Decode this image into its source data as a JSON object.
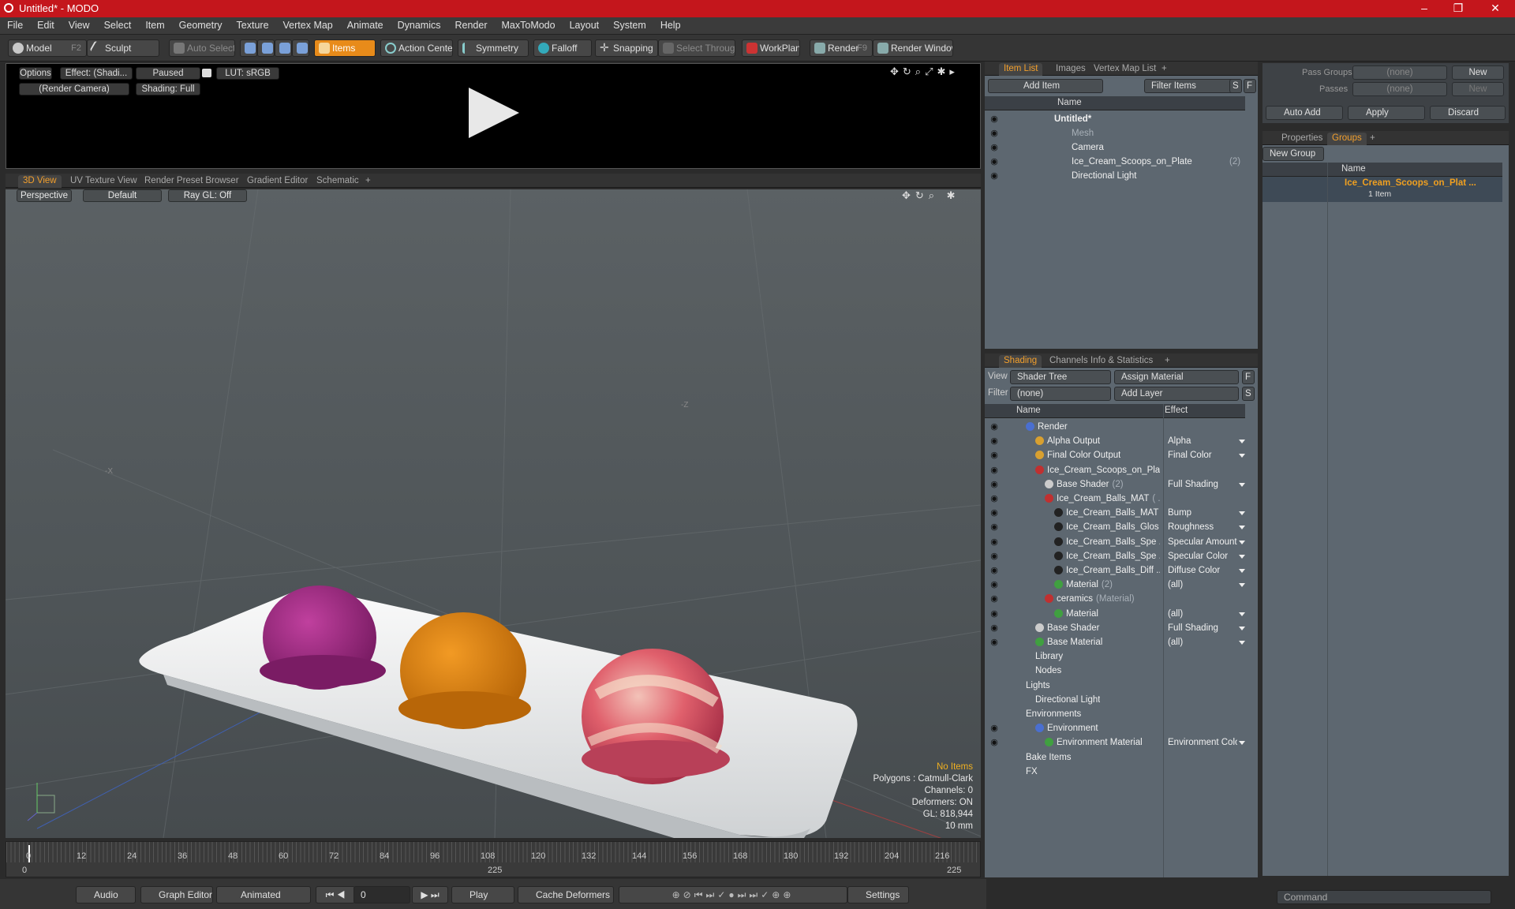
{
  "window": {
    "title": "Untitled* - MODO",
    "min": "–",
    "max": "❐",
    "close": "✕"
  },
  "menu": [
    "File",
    "Edit",
    "View",
    "Select",
    "Item",
    "Geometry",
    "Texture",
    "Vertex Map",
    "Animate",
    "Dynamics",
    "Render",
    "MaxToModo",
    "Layout",
    "System",
    "Help"
  ],
  "toolbar": {
    "model": "Model",
    "model_key": "F2",
    "sculpt": "Sculpt",
    "auto_select": "Auto Select",
    "items": "Items",
    "action_center": "Action Center",
    "symmetry": "Symmetry",
    "falloff": "Falloff",
    "snapping": "Snapping",
    "select_through": "Select Through",
    "workplane": "WorkPlane",
    "render": "Render",
    "render_key": "F9",
    "render_window": "Render Window"
  },
  "preview": {
    "options": "Options",
    "effect": "Effect: (Shadi...",
    "paused": "Paused",
    "lut": "LUT: sRGB",
    "camera": "(Render Camera)",
    "shading": "Shading: Full"
  },
  "view_tabs": [
    "3D View",
    "UV Texture View",
    "Render Preset Browser",
    "Gradient Editor",
    "Schematic",
    "+"
  ],
  "viewport": {
    "perspective": "Perspective",
    "default": "Default",
    "raygl": "Ray GL: Off",
    "axis_x": "-X",
    "axis_z": "-Z",
    "stats": {
      "no_items": "No Items",
      "polygons": "Polygons : Catmull-Clark",
      "channels": "Channels: 0",
      "deformers": "Deformers: ON",
      "gl": "GL: 818,944",
      "scale": "10 mm"
    }
  },
  "timeline": {
    "ticks": [
      "0",
      "12",
      "24",
      "36",
      "48",
      "60",
      "72",
      "84",
      "96",
      "108",
      "120",
      "132",
      "144",
      "156",
      "168",
      "180",
      "192",
      "204",
      "216"
    ],
    "start": "0",
    "mid": "225",
    "end": "225"
  },
  "bottom": {
    "audio": "Audio",
    "graph_editor": "Graph Editor",
    "animated": "Animated",
    "frame": "0",
    "play": "Play",
    "cache": "Cache Deformers",
    "settings": "Settings"
  },
  "item_panel": {
    "tabs": [
      "Item List",
      "Images",
      "Vertex Map List",
      "+"
    ],
    "add_item": "Add Item",
    "filter_items": "Filter Items",
    "s": "S",
    "f": "F",
    "name_col": "Name",
    "items": [
      {
        "label": "Untitled*",
        "bold": true,
        "indent": 0
      },
      {
        "label": "Mesh",
        "dim": true,
        "indent": 1
      },
      {
        "label": "Camera",
        "indent": 1
      },
      {
        "label": "Ice_Cream_Scoops_on_Plate",
        "count": "(2)",
        "indent": 1
      },
      {
        "label": "Directional Light",
        "indent": 1
      }
    ]
  },
  "shading_panel": {
    "tabs": [
      "Shading",
      "Channels",
      "Info & Statistics",
      "+"
    ],
    "view_label": "View",
    "view_value": "Shader Tree",
    "assign_material": "Assign Material",
    "filter_label": "Filter",
    "filter_value": "(none)",
    "add_layer": "Add Layer",
    "f": "F",
    "s": "S",
    "name_col": "Name",
    "effect_col": "Effect",
    "rows": [
      {
        "name": "Render",
        "effect": "",
        "indent": 0,
        "color": "#4a6fd0"
      },
      {
        "name": "Alpha Output",
        "effect": "Alpha",
        "indent": 1,
        "color": "#d8a030"
      },
      {
        "name": "Final Color Output",
        "effect": "Final Color",
        "indent": 1,
        "color": "#d8a030"
      },
      {
        "name": "Ice_Cream_Scoops_on_Pla...",
        "effect": "",
        "indent": 1,
        "color": "#c03030"
      },
      {
        "name": "Base Shader",
        "extra": "(2)",
        "effect": "Full Shading",
        "indent": 2,
        "color": "#cccccc"
      },
      {
        "name": "Ice_Cream_Balls_MAT",
        "extra": "( ...",
        "effect": "",
        "indent": 2,
        "color": "#c03030"
      },
      {
        "name": "Ice_Cream_Balls_MAT ...",
        "effect": "Bump",
        "indent": 3,
        "color": "#222222"
      },
      {
        "name": "Ice_Cream_Balls_Glos ...",
        "effect": "Roughness",
        "indent": 3,
        "color": "#222222"
      },
      {
        "name": "Ice_Cream_Balls_Spe ...",
        "effect": "Specular Amount",
        "indent": 3,
        "color": "#222222"
      },
      {
        "name": "Ice_Cream_Balls_Spe ...",
        "effect": "Specular Color",
        "indent": 3,
        "color": "#222222"
      },
      {
        "name": "Ice_Cream_Balls_Diff ...",
        "effect": "Diffuse Color",
        "indent": 3,
        "color": "#222222"
      },
      {
        "name": "Material",
        "extra": "(2)",
        "effect": "(all)",
        "indent": 3,
        "color": "#40a040"
      },
      {
        "name": "ceramics",
        "extra": "(Material)",
        "effect": "",
        "indent": 2,
        "color": "#c03030"
      },
      {
        "name": "Material",
        "effect": "(all)",
        "indent": 3,
        "color": "#40a040"
      },
      {
        "name": "Base Shader",
        "effect": "Full Shading",
        "indent": 1,
        "color": "#cccccc"
      },
      {
        "name": "Base Material",
        "effect": "(all)",
        "indent": 1,
        "color": "#40a040"
      },
      {
        "name": "Library",
        "effect": "",
        "indent": 1,
        "color": ""
      },
      {
        "name": "Nodes",
        "effect": "",
        "indent": 1,
        "color": ""
      },
      {
        "name": "Lights",
        "effect": "",
        "indent": 0,
        "color": ""
      },
      {
        "name": "Directional Light",
        "effect": "",
        "indent": 1,
        "color": ""
      },
      {
        "name": "Environments",
        "effect": "",
        "indent": 0,
        "color": ""
      },
      {
        "name": "Environment",
        "effect": "",
        "indent": 1,
        "color": "#4a6fd0"
      },
      {
        "name": "Environment Material",
        "effect": "Environment Color",
        "indent": 2,
        "color": "#40a040"
      },
      {
        "name": "Bake Items",
        "effect": "",
        "indent": 0,
        "color": ""
      },
      {
        "name": "FX",
        "effect": "",
        "indent": 0,
        "color": ""
      }
    ]
  },
  "groups_panel": {
    "pass_groups": "Pass Groups",
    "passes": "Passes",
    "none1": "(none)",
    "none2": "(none)",
    "new": "New",
    "new2": "New",
    "auto_add": "Auto Add",
    "apply": "Apply",
    "discard": "Discard",
    "tabs": [
      "Properties",
      "Groups",
      "+"
    ],
    "new_group": "New Group",
    "name_col": "Name",
    "group_name": "Ice_Cream_Scoops_on_Plat ...",
    "group_count": "1 Item"
  },
  "command": {
    "placeholder": "Command"
  }
}
